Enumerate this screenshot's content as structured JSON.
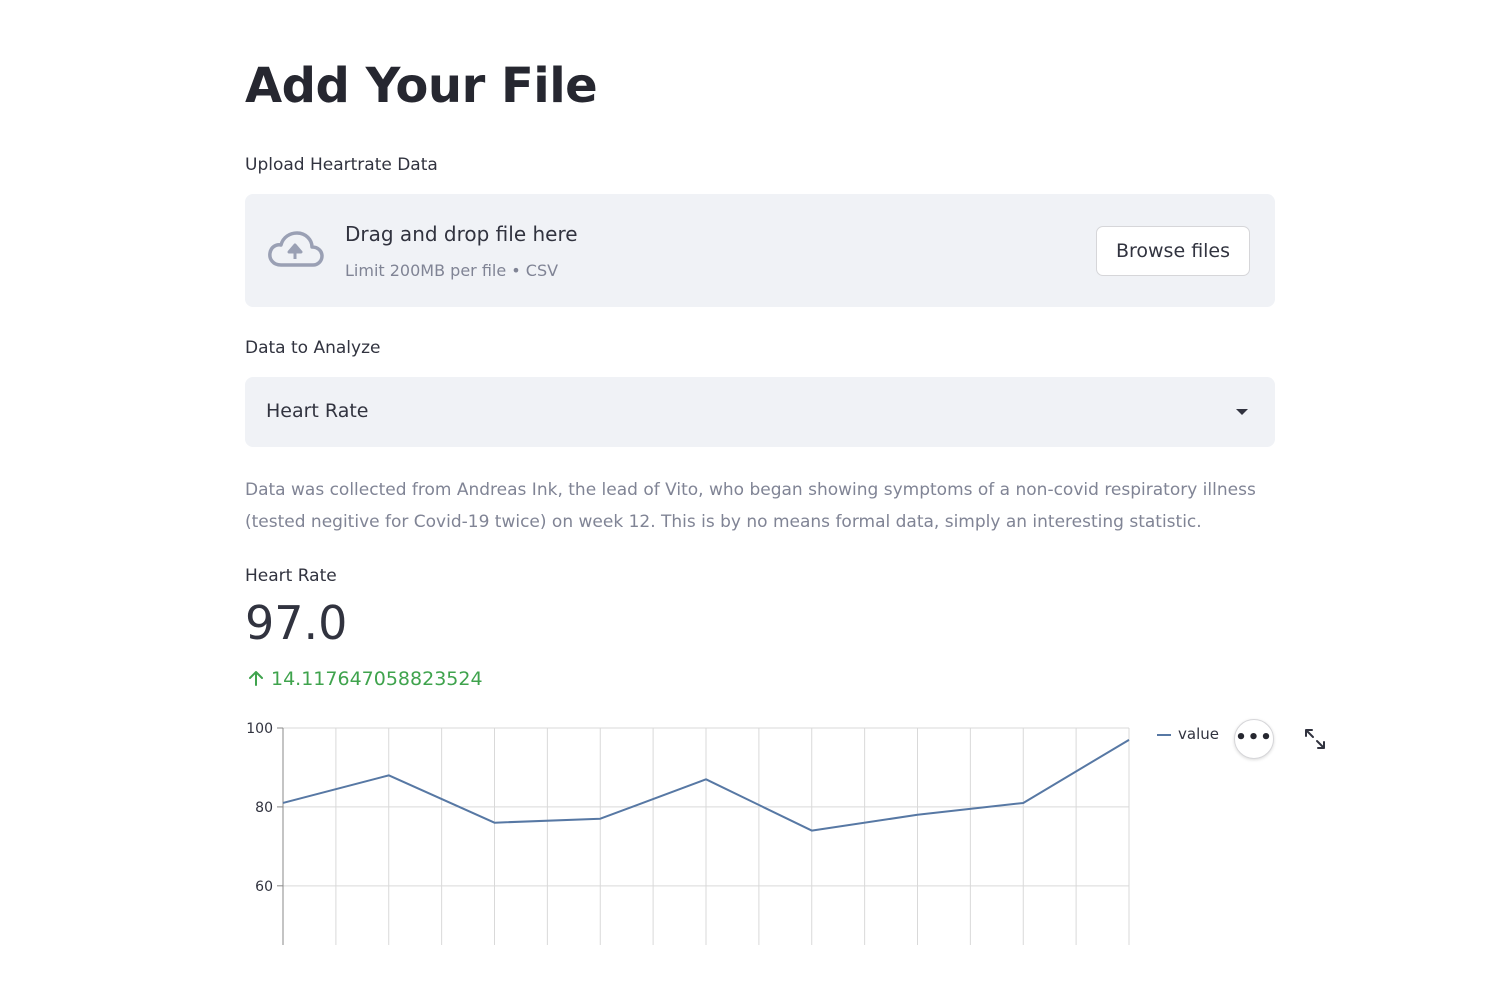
{
  "title": "Add Your File",
  "uploader": {
    "label": "Upload Heartrate Data",
    "drag_text": "Drag and drop file here",
    "limit_text": "Limit 200MB per file • CSV",
    "browse_label": "Browse files",
    "icon": "cloud-upload-icon"
  },
  "selector": {
    "label": "Data to Analyze",
    "selected": "Heart Rate",
    "icon": "caret-down-icon"
  },
  "description": "Data was collected from Andreas Ink, the lead of Vito, who began showing symptoms of a non-covid respiratory illness (tested negitive for Covid-19 twice) on week 12. This is by no means formal data, simply an interesting statistic.",
  "metric": {
    "label": "Heart Rate",
    "value": "97.0",
    "delta": "14.117647058823524",
    "delta_direction": "up",
    "delta_color": "#3fa34d"
  },
  "chart_toolbar": {
    "more_icon": "more-horizontal-icon",
    "expand_icon": "expand-icon"
  },
  "chart_data": {
    "type": "line",
    "x": [
      0,
      1,
      2,
      3,
      4,
      5,
      6,
      7,
      8,
      9,
      10,
      11,
      12,
      13,
      14,
      15,
      16
    ],
    "series": [
      {
        "name": "value",
        "color": "#5778a4",
        "values": [
          81,
          null,
          88,
          null,
          76,
          null,
          77,
          null,
          87,
          null,
          74,
          null,
          78,
          null,
          81,
          null,
          97
        ]
      }
    ],
    "y_ticks": [
      "100",
      "80",
      "60"
    ],
    "ylim": [
      45,
      100
    ],
    "grid": true,
    "legend": "top-right"
  }
}
